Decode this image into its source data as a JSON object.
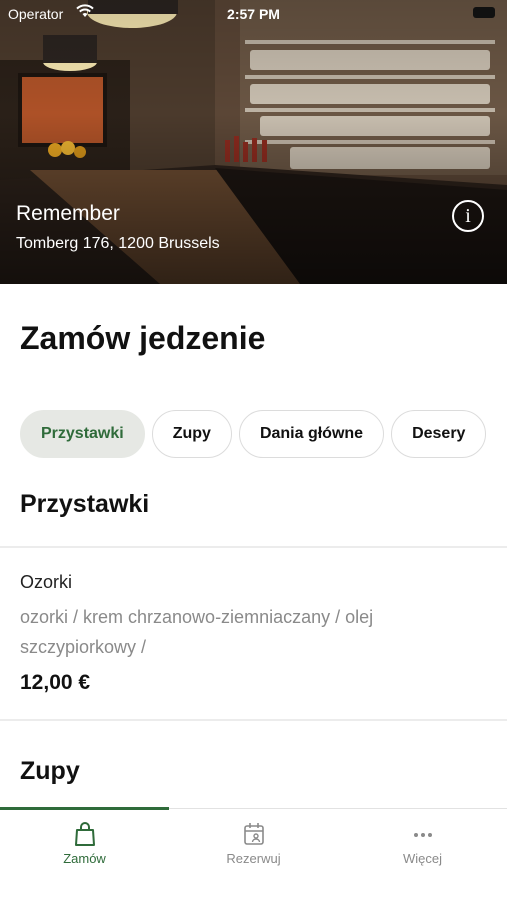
{
  "status_bar": {
    "carrier": "Operator",
    "time": "2:57 PM"
  },
  "venue": {
    "name": "Remember",
    "address": "Tomberg 176, 1200 Brussels"
  },
  "page_title": "Zamów jedzenie",
  "categories": [
    {
      "label": "Przystawki",
      "active": true
    },
    {
      "label": "Zupy",
      "active": false
    },
    {
      "label": "Dania główne",
      "active": false
    },
    {
      "label": "Desery",
      "active": false
    }
  ],
  "sections": [
    {
      "title": "Przystawki",
      "items": [
        {
          "name": "Ozorki",
          "description": "ozorki / krem chrzanowo-ziemniaczany / olej szczypiorkowy /",
          "price": "12,00 €"
        }
      ]
    },
    {
      "title": "Zupy",
      "items": []
    }
  ],
  "tabs": [
    {
      "label": "Zamów",
      "icon": "shopping-bag-icon",
      "active": true
    },
    {
      "label": "Rezerwuj",
      "icon": "calendar-icon",
      "active": false
    },
    {
      "label": "Więcej",
      "icon": "more-dots-icon",
      "active": false
    }
  ],
  "colors": {
    "accent": "#2f6b3a",
    "chip_active_bg": "#e6e8e4",
    "muted_text": "#8a8a8a"
  }
}
